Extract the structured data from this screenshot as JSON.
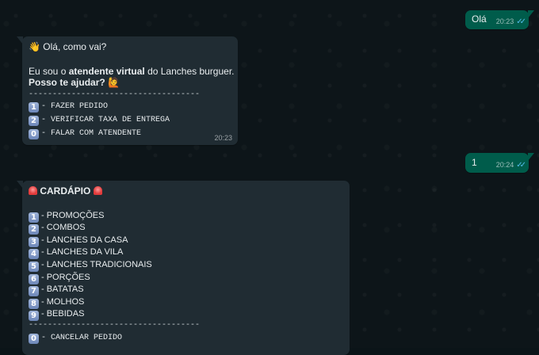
{
  "messages": {
    "m1": {
      "text": "Olá",
      "time": "20:23",
      "ticks": "✓✓"
    },
    "m2": {
      "greeting": "Olá, como vai?",
      "wave_emoji": "👋",
      "intro_pre": "Eu sou o ",
      "intro_bold": "atendente virtual",
      "intro_post": " do Lanches burguer.",
      "question": "Posso te ajudar?",
      "question_emoji": "🙋",
      "divider": "------------------------------------",
      "options": [
        {
          "key": "1",
          "label": "- FAZER PEDIDO"
        },
        {
          "key": "2",
          "label": "- VERIFICAR TAXA DE ENTREGA"
        },
        {
          "key": "0",
          "label": "- FALAR COM ATENDENTE"
        }
      ],
      "time": "20:23"
    },
    "m3": {
      "text": "1",
      "time": "20:24",
      "ticks": "✓✓"
    },
    "m4": {
      "title": "CARDÁPIO",
      "items": [
        {
          "key": "1",
          "label": "- PROMOÇÕES"
        },
        {
          "key": "2",
          "label": "- COMBOS"
        },
        {
          "key": "3",
          "label": "- LANCHES DA CASA"
        },
        {
          "key": "4",
          "label": "- LANCHES DA VILA"
        },
        {
          "key": "5",
          "label": "- LANCHES TRADICIONAIS"
        },
        {
          "key": "6",
          "label": "- PORÇÕES"
        },
        {
          "key": "7",
          "label": "- BATATAS"
        },
        {
          "key": "8",
          "label": "- MOLHOS"
        },
        {
          "key": "9",
          "label": "- BEBIDAS"
        }
      ],
      "divider": "------------------------------------",
      "cancel": {
        "key": "0",
        "label": "- CANCELAR PEDIDO"
      }
    }
  }
}
